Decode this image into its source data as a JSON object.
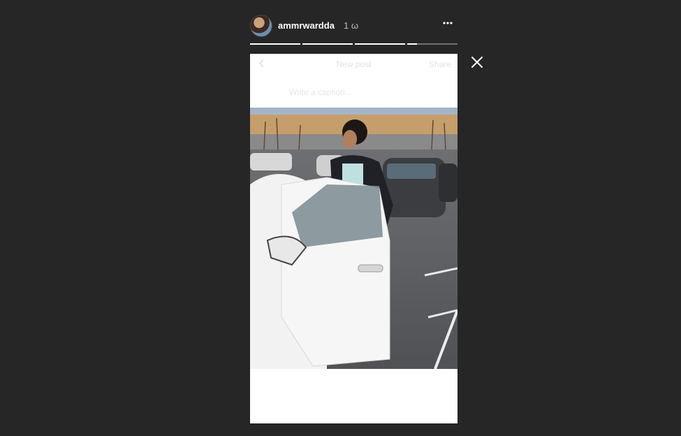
{
  "story": {
    "username": "ammrwardda",
    "timestamp": "1 ω",
    "more_icon": "ellipsis-icon",
    "close_icon": "close-icon",
    "progress": [
      1.0,
      1.0,
      1.0,
      0.2
    ]
  },
  "screenshot_content": {
    "back_icon": "chevron-left-icon",
    "title": "New post",
    "share_label": "Share",
    "caption_placeholder": "Write a caption..."
  }
}
